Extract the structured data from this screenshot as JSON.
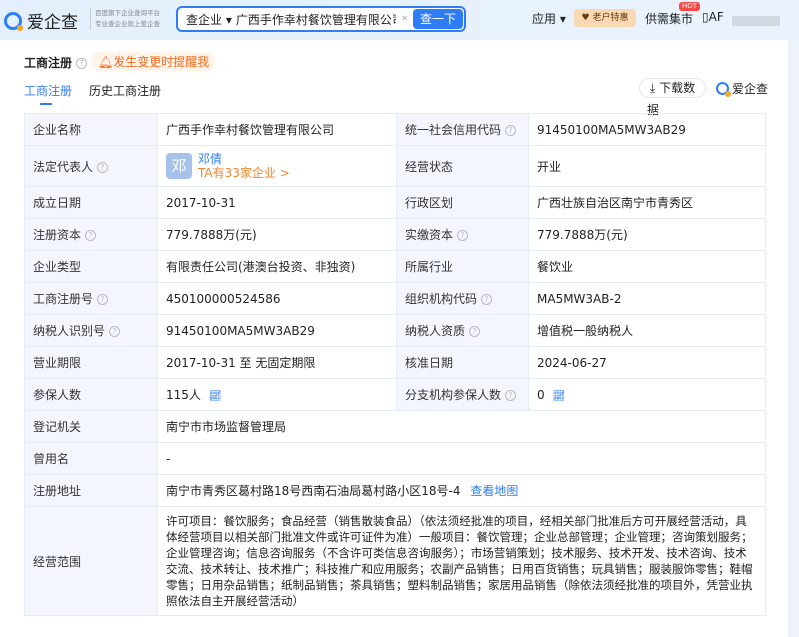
{
  "header": {
    "logo": "爱企查",
    "slogan": [
      "百度旗下企业查询平台",
      "专业查企业就上爱企查"
    ],
    "search_type": "查企业",
    "search_value": "广西手作幸村餐饮管理有限公司",
    "search_button": "查一下",
    "nav_apps": "应用",
    "nav_vip": "老户特惠",
    "nav_market": "供需集市",
    "hot_badge": "HOT",
    "user": "AF"
  },
  "section": {
    "title": "工商注册",
    "remind": "发生变更时提醒我",
    "tabs": [
      "工商注册",
      "历史工商注册"
    ],
    "download": "下载数",
    "download_wrap": "据",
    "brand": "爱企查"
  },
  "rows": [
    {
      "l1": "企业名称",
      "v1": "广西手作幸村餐饮管理有限公司",
      "l2": "统一社会信用代码",
      "v2": "91450100MA5MW3AB29"
    },
    {
      "l1": "法定代表人",
      "v1": "",
      "l2": "经营状态",
      "v2": "开业"
    },
    {
      "l1": "成立日期",
      "v1": "2017-10-31",
      "l2": "行政区划",
      "v2": "广西壮族自治区南宁市青秀区"
    },
    {
      "l1": "注册资本",
      "v1": "779.7888万(元)",
      "l2": "实缴资本",
      "v2": "779.7888万(元)"
    },
    {
      "l1": "企业类型",
      "v1": "有限责任公司(港澳台投资、非独资)",
      "l2": "所属行业",
      "v2": "餐饮业"
    },
    {
      "l1": "工商注册号",
      "v1": "450100000524586",
      "l2": "组织机构代码",
      "v2": "MA5MW3AB-2"
    },
    {
      "l1": "纳税人识别号",
      "v1": "91450100MA5MW3AB29",
      "l2": "纳税人资质",
      "v2": "增值税一般纳税人"
    },
    {
      "l1": "营业期限",
      "v1": "2017-10-31 至 无固定期限",
      "l2": "核准日期",
      "v2": "2024-06-27"
    },
    {
      "l1": "参保人数",
      "v1": "115人",
      "l2": "分支机构参保人数",
      "v2": "0"
    }
  ],
  "legal_rep": {
    "avatar": "邓",
    "name": "邓倩",
    "companies": "TA有33家企业 >"
  },
  "authority": {
    "label": "登记机关",
    "value": "南宁市市场监督管理局"
  },
  "former": {
    "label": "曾用名",
    "value": "-"
  },
  "address": {
    "label": "注册地址",
    "value": "南宁市青秀区葛村路18号西南石油局葛村路小区18号-4",
    "link": "查看地图"
  },
  "scope": {
    "label": "经营范围",
    "value": "许可项目：餐饮服务；食品经营（销售散装食品）（依法须经批准的项目，经相关部门批准后方可开展经营活动，具体经营项目以相关部门批准文件或许可证件为准）一般项目：餐饮管理；企业总部管理；企业管理；咨询策划服务；企业管理咨询；信息咨询服务（不含许可类信息咨询服务）；市场营销策划；技术服务、技术开发、技术咨询、技术交流、技术转让、技术推广；科技推广和应用服务；农副产品销售；日用百货销售；玩具销售；服装服饰零售；鞋帽零售；日用杂品销售；纸制品销售；茶具销售；塑料制品销售；家居用品销售（除依法须经批准的项目外，凭营业执照依法自主开展经营活动）"
  }
}
